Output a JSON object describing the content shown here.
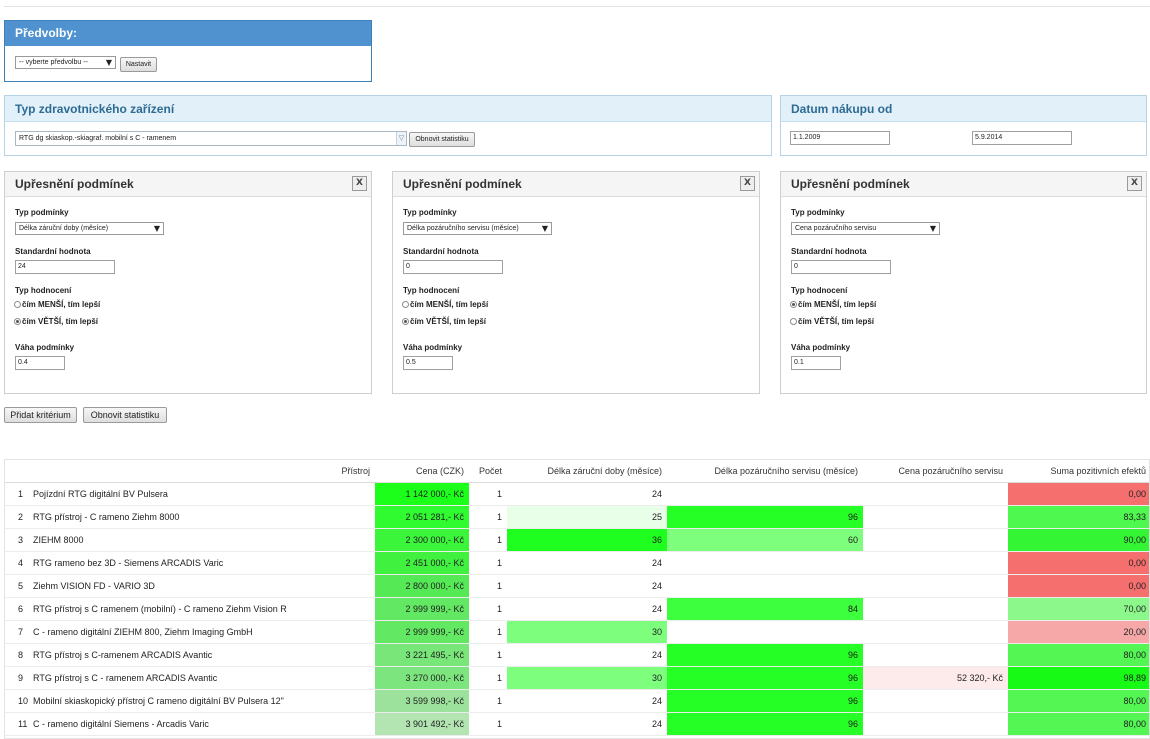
{
  "preferences": {
    "title": "Předvolby:",
    "select_value": "-- vyberte předvolbu --",
    "set_button": "Nastavit"
  },
  "device_type": {
    "title": "Typ zdravotnického zařízení",
    "select_value": "RTG dg skiaskop.-skiagraf. mobilní s C - ramenem",
    "refresh_button": "Obnovit statistiku"
  },
  "purchase_date": {
    "title": "Datum nákupu od",
    "from": "1.1.2009",
    "to": "5.9.2014"
  },
  "criteria_labels": {
    "title": "Upřesnění podmínek",
    "close": "X",
    "type_label": "Typ podmínky",
    "standard_label": "Standardní hodnota",
    "rating_label": "Typ hodnocení",
    "rating_less": "čím MENŠÍ, tím lepší",
    "rating_more": "čím VĚTŠÍ, tím lepší",
    "weight_label": "Váha podmínky"
  },
  "criteria": [
    {
      "type": "Délka záruční doby (měsíce)",
      "standard": "24",
      "rating": "more",
      "weight": "0.4"
    },
    {
      "type": "Délka pozáručního servisu (měsíce)",
      "standard": "0",
      "rating": "more",
      "weight": "0.5"
    },
    {
      "type": "Cena pozáručního servisu",
      "standard": "0",
      "rating": "less",
      "weight": "0.1"
    }
  ],
  "actions": {
    "add_criterion": "Přidat kritérium",
    "refresh": "Obnovit statistiku"
  },
  "table": {
    "headers": [
      "Přístroj",
      "Cena (CZK)",
      "Počet",
      "Délka záruční doby (měsíce)",
      "Délka pozáručního servisu (měsíce)",
      "Cena pozáručního servisu",
      "Suma pozitivních efektů"
    ],
    "rows": [
      {
        "n": "1",
        "name": "Pojízdní RTG digitální BV Pulsera",
        "price": "1 142 000,- Kč",
        "count": "1",
        "warranty": "24",
        "service": "",
        "service_price": "",
        "sum": "0,00",
        "colors": [
          "#1bff1b",
          "#ffffff",
          "#ffffff",
          "#ffffff",
          "#ffffff",
          "#f66f6f"
        ]
      },
      {
        "n": "2",
        "name": "RTG přístroj - C rameno Ziehm 8000",
        "price": "2 051 281,- Kč",
        "count": "1",
        "warranty": "25",
        "service": "96",
        "service_price": "",
        "sum": "83,33",
        "colors": [
          "#30fa30",
          "#ffffff",
          "#e8ffe8",
          "#25ff25",
          "#ffffff",
          "#4ef84e"
        ]
      },
      {
        "n": "3",
        "name": "ZIEHM 8000",
        "price": "2 300 000,- Kč",
        "count": "1",
        "warranty": "36",
        "service": "60",
        "service_price": "",
        "sum": "90,00",
        "colors": [
          "#3af53a",
          "#ffffff",
          "#1fff1f",
          "#7dff7d",
          "#ffffff",
          "#34f534"
        ]
      },
      {
        "n": "4",
        "name": "RTG rameno bez 3D - Siemens ARCADIS Varic",
        "price": "2 451 000,- Kč",
        "count": "1",
        "warranty": "24",
        "service": "",
        "service_price": "",
        "sum": "0,00",
        "colors": [
          "#40f140",
          "#ffffff",
          "#ffffff",
          "#ffffff",
          "#ffffff",
          "#f66f6f"
        ]
      },
      {
        "n": "5",
        "name": "Ziehm VISION FD - VARIO 3D",
        "price": "2 800 000,- Kč",
        "count": "1",
        "warranty": "24",
        "service": "",
        "service_price": "",
        "sum": "0,00",
        "colors": [
          "#55ea55",
          "#ffffff",
          "#ffffff",
          "#ffffff",
          "#ffffff",
          "#f66f6f"
        ]
      },
      {
        "n": "6",
        "name": "RTG přístroj s C ramenem (mobilní) - C rameno Ziehm Vision R",
        "price": "2 999 999,- Kč",
        "count": "1",
        "warranty": "24",
        "service": "84",
        "service_price": "",
        "sum": "70,00",
        "colors": [
          "#62e862",
          "#ffffff",
          "#ffffff",
          "#3dff3d",
          "#ffffff",
          "#8cf88c"
        ]
      },
      {
        "n": "7",
        "name": "C - rameno digitální ZIEHM 800, Ziehm Imaging GmbH",
        "price": "2 999 999,- Kč",
        "count": "1",
        "warranty": "30",
        "service": "",
        "service_price": "",
        "sum": "20,00",
        "colors": [
          "#62e862",
          "#ffffff",
          "#7dff7d",
          "#ffffff",
          "#ffffff",
          "#f6a8a8"
        ]
      },
      {
        "n": "8",
        "name": "RTG přístroj s C-ramenem ARCADIS Avantic",
        "price": "3 221 495,- Kč",
        "count": "1",
        "warranty": "24",
        "service": "96",
        "service_price": "",
        "sum": "80,00",
        "colors": [
          "#78e678",
          "#ffffff",
          "#ffffff",
          "#25ff25",
          "#ffffff",
          "#54f654"
        ]
      },
      {
        "n": "9",
        "name": "RTG přístroj s C - ramenem ARCADIS Avantic",
        "price": "3 270 000,- Kč",
        "count": "1",
        "warranty": "30",
        "service": "96",
        "service_price": "52 320,- Kč",
        "sum": "98,89",
        "colors": [
          "#7de57d",
          "#ffffff",
          "#7dff7d",
          "#25ff25",
          "#fdeaea",
          "#16fa16"
        ]
      },
      {
        "n": "10",
        "name": "Mobilní skiaskopický přístroj C rameno digitální BV Pulsera 12\"",
        "price": "3 599 998,- Kč",
        "count": "1",
        "warranty": "24",
        "service": "96",
        "service_price": "",
        "sum": "80,00",
        "colors": [
          "#9ce29c",
          "#ffffff",
          "#ffffff",
          "#25ff25",
          "#ffffff",
          "#54f654"
        ]
      },
      {
        "n": "11",
        "name": "C - rameno digitální Siemens - Arcadis Varic",
        "price": "3 901 492,- Kč",
        "count": "1",
        "warranty": "24",
        "service": "96",
        "service_price": "",
        "sum": "80,00",
        "colors": [
          "#b2e5b2",
          "#ffffff",
          "#ffffff",
          "#25ff25",
          "#ffffff",
          "#54f654"
        ]
      }
    ]
  }
}
